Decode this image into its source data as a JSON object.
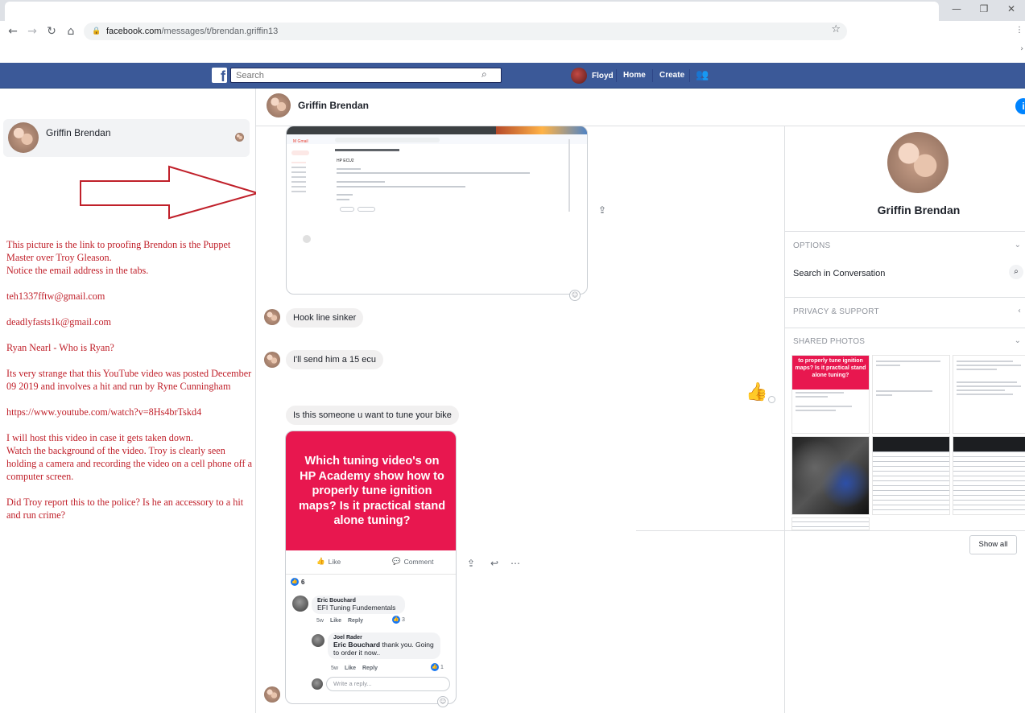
{
  "browser": {
    "url_host": "facebook.com",
    "url_path": "/messages/t/brendan.griffin13",
    "icons": {
      "back": "back-arrow-icon",
      "forward": "forward-arrow-icon",
      "reload": "reload-icon",
      "home": "home-icon",
      "lock": "lock-icon",
      "star": "star-icon"
    }
  },
  "fb_header": {
    "logo": "f",
    "search_placeholder": "Search",
    "user_name": "Floyd",
    "home_label": "Home",
    "create_label": "Create",
    "brand_color": "#3b5998"
  },
  "conversation_list": {
    "items": [
      {
        "name": "Griffin Brendan"
      }
    ]
  },
  "annotation": {
    "color": "#c0202a",
    "lines": [
      "This picture is the link to proofing Brendon is the Puppet Master over Troy Gleason.",
      "Notice the email address in the tabs.",
      "teh1337fftw@gmail.com",
      "deadlyfasts1k@gmail.com",
      "Ryan Nearl - Who is Ryan?",
      "Its very strange that this YouTube video was posted December 09 2019 and involves a hit and run by Ryne Cunningham",
      "https://www.youtube.com/watch?v=8Hs4brTskd4",
      "I will host this video in case it gets taken down.",
      "Watch the background of the video. Troy is clearly seen holding a camera and recording the video on a cell phone off a computer screen.",
      "Did Troy report this to the police? Is he an accessory to a hit and run crime?"
    ]
  },
  "chat": {
    "title": "Griffin Brendan",
    "info_icon": "i",
    "messages": [
      {
        "type": "image",
        "caption": "HP ECU2"
      },
      {
        "type": "text",
        "text": "Hook line sinker"
      },
      {
        "type": "text",
        "text": "I'll send him a 15 ecu"
      },
      {
        "type": "like"
      },
      {
        "type": "text",
        "text": "Is this someone u want to tune your bike"
      }
    ],
    "post": {
      "headline": "Which tuning video's on HP Academy show how to properly tune ignition maps? Is it practical stand alone tuning?",
      "like_label": "Like",
      "comment_label": "Comment",
      "reaction_count": "6",
      "comments": [
        {
          "name": "Eric Bouchard",
          "text": "EFI Tuning Fundementals",
          "age": "5w",
          "like": "Like",
          "reply": "Reply",
          "likes": "3"
        },
        {
          "name": "Joel Rader",
          "mention": "Eric Bouchard",
          "text": " thank you. Going to order it now..",
          "age": "5w",
          "like": "Like",
          "reply": "Reply",
          "likes": "1"
        }
      ],
      "reply_placeholder": "Write a reply..."
    }
  },
  "info_pane": {
    "name": "Griffin Brendan",
    "options_label": "OPTIONS",
    "search_label": "Search in Conversation",
    "privacy_label": "PRIVACY & SUPPORT",
    "shared_photos_label": "SHARED PHOTOS",
    "photo1_text": "to properly tune ignition maps? Is it practical stand alone tuning?",
    "show_all_label": "Show all"
  }
}
